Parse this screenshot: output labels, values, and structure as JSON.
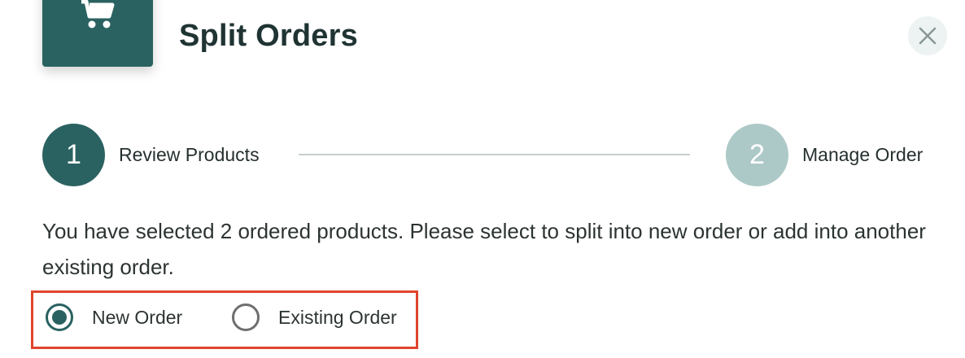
{
  "dialog": {
    "title": "Split Orders",
    "header_icon": "shopping-cart-icon",
    "close_icon": "close-icon"
  },
  "stepper": {
    "steps": [
      {
        "number": "1",
        "label": "Review Products",
        "state": "active"
      },
      {
        "number": "2",
        "label": "Manage Order",
        "state": "inactive"
      }
    ]
  },
  "instruction": "You have selected 2 ordered products. Please select to split into new order or add into another existing order.",
  "split_options": {
    "options": [
      {
        "label": "New Order",
        "selected": true
      },
      {
        "label": "Existing Order",
        "selected": false
      }
    ]
  },
  "colors": {
    "primary": "#2a6261",
    "primary_light": "#adc9c7",
    "highlight_border": "#e0452c",
    "close_bg": "#edf3f2"
  }
}
